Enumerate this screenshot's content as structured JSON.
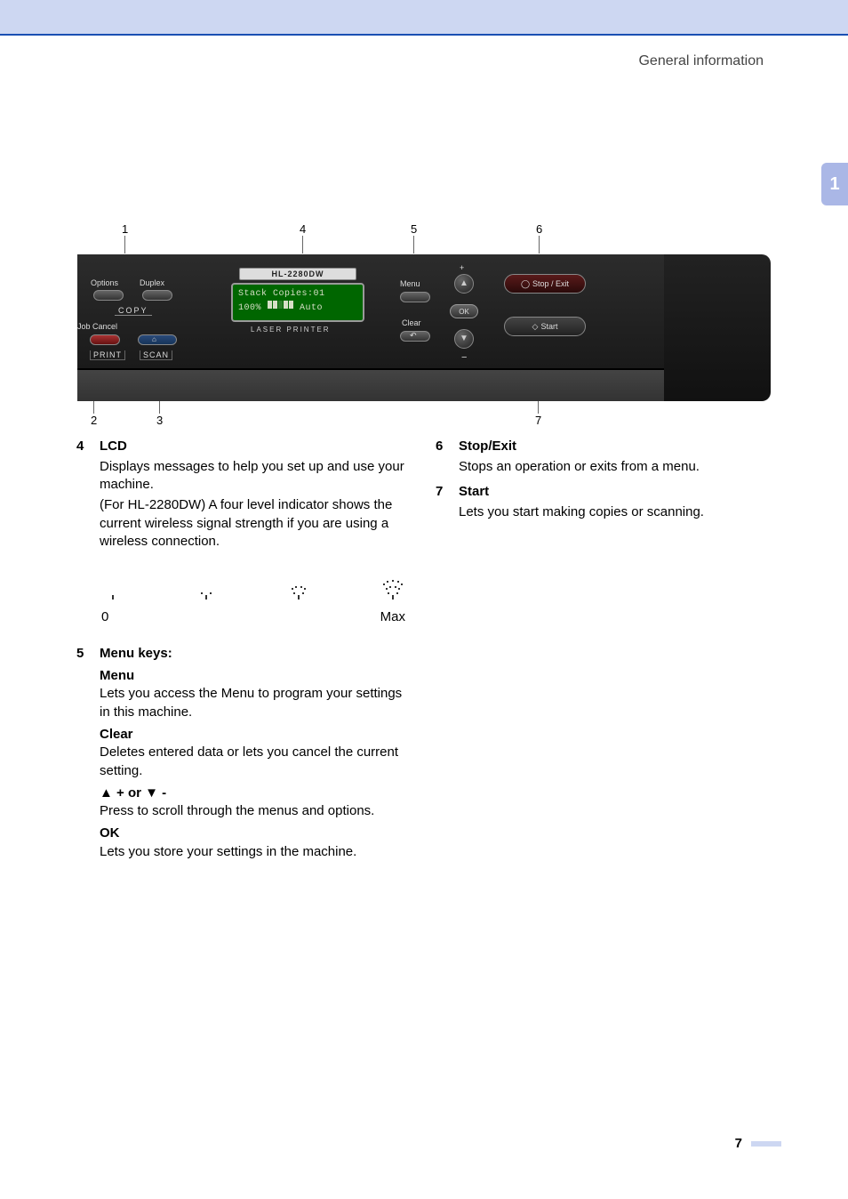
{
  "header": {
    "section": "General information"
  },
  "side_tab": {
    "number": "1"
  },
  "panel": {
    "callout_top": [
      "1",
      "4",
      "5",
      "6"
    ],
    "callout_bottom": [
      "2",
      "3",
      "7"
    ],
    "labels": {
      "options": "Options",
      "duplex": "Duplex",
      "copy": "COPY",
      "job_cancel": "Job Cancel",
      "print": "PRINT",
      "scan": "SCAN",
      "menu": "Menu",
      "clear": "Clear",
      "ok": "OK",
      "plus": "+",
      "minus": "−",
      "stop_exit": "Stop / Exit",
      "start": "Start"
    },
    "model": "HL-2280DW",
    "lcd": {
      "line1": "Stack  Copies:01",
      "line2_left": "100%",
      "line2_right": "Auto"
    },
    "laser": "LASER PRINTER"
  },
  "sections": {
    "s4": {
      "num": "4",
      "title": "LCD",
      "p1": "Displays messages to help you set up and use your machine.",
      "p2": "(For HL-2280DW) A four level indicator shows the current wireless signal strength if you are using a wireless connection.",
      "scale_min": "0",
      "scale_max": "Max"
    },
    "s5": {
      "num": "5",
      "title": "Menu keys:",
      "menu_t": "Menu",
      "menu_d": "Lets you access the Menu to program your settings in this machine.",
      "clear_t": "Clear",
      "clear_d": "Deletes entered data or lets you cancel the current setting.",
      "arrow_t": "▲ + or ▼ -",
      "arrow_d": "Press to scroll through the menus and options.",
      "ok_t": "OK",
      "ok_d": "Lets you store your settings in the machine."
    },
    "s6": {
      "num": "6",
      "title": "Stop/Exit",
      "desc": "Stops an operation or exits from a menu."
    },
    "s7": {
      "num": "7",
      "title": "Start",
      "desc": "Lets you start making copies or scanning."
    }
  },
  "page_number": "7"
}
